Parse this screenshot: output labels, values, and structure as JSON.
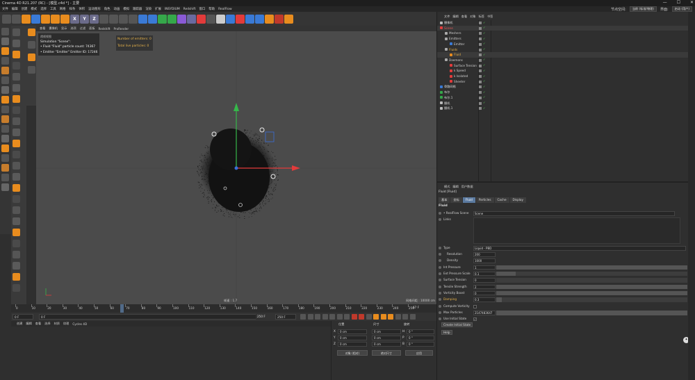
{
  "title": "Cinema 4D R21.207 (RC) - [模型.c4d *] - 主要",
  "menubar": [
    "文件",
    "编辑",
    "创建",
    "模式",
    "选择",
    "工具",
    "网格",
    "样条",
    "体积",
    "运动图形",
    "角色",
    "动画",
    "模拟",
    "跟踪器",
    "渲染",
    "扩展",
    "INSYDIUM",
    "Redshift",
    "窗口",
    "帮助",
    "RealFlow"
  ],
  "right_menubar": {
    "node_label": "节点空间:",
    "node_value": "当前 (标准/物理)",
    "layout_label": "界面:",
    "layout_value": "启动 (用户)"
  },
  "toolbar_icons": [
    "undo-icon",
    "redo-icon",
    "live-select-icon",
    "move-icon",
    "scale-icon",
    "rotate-icon",
    "recent-tool-icon",
    "x-axis-icon",
    "y-axis-icon",
    "z-axis-icon",
    "coordinate-system-icon",
    "render-view-icon",
    "render-picture-viewer-icon",
    "edit-render-settings-icon",
    "cube-icon",
    "spline-pen-icon",
    "subdivision-icon",
    "cloner-icon",
    "deformer-icon",
    "field-icon",
    "scene-icon",
    "camera-icon",
    "light-icon",
    "fluid-icon",
    "emitter-icon",
    "mesher-icon",
    "daemon-icon",
    "xp-icon",
    "redshift-icon",
    "octane-icon"
  ],
  "toolbar_axis_labels": {
    "x": "X",
    "y": "Y",
    "z": "Z"
  },
  "viewport_menu": [
    "查看",
    "摄像机",
    "显示",
    "选项",
    "过滤",
    "面板",
    "Redshift",
    "ProRender"
  ],
  "viewport_view_label": "透视视图",
  "simulation_info": {
    "title": "Simulation \"Scene\":",
    "fluid_line": "• Fluid \"Fluid\" particle count: 74367",
    "emitter_line": "• Emitter \"Emitter\" Emitter ID: 17246"
  },
  "emitter_stats": {
    "emitters": "Number of emitters: 0",
    "particles": "Total live particles: 0"
  },
  "viewport_footer": {
    "fps": "帧速 : 1.7",
    "grid": "网格间距 : 10000 cm"
  },
  "timeline_ticks": [
    "0",
    "10",
    "20",
    "30",
    "40",
    "50",
    "60",
    "70",
    "80",
    "90",
    "100",
    "110",
    "120",
    "130",
    "140",
    "150",
    "160",
    "170",
    "180",
    "190",
    "200",
    "210",
    "220",
    "230",
    "240",
    "250"
  ],
  "timeline_current": "67 F",
  "transport": {
    "start": "0 F",
    "current": "0 F",
    "end_min": "250 F",
    "end_max": "250 F"
  },
  "bottom_menu": [
    "创建",
    "编辑",
    "查看",
    "选择",
    "材质",
    "纹理",
    "Cycles 4D"
  ],
  "coord_panel": {
    "h_pos": "位置",
    "h_size": "尺寸",
    "h_rot": "旋转",
    "rows": [
      {
        "axis": "X",
        "pos": "0 cm",
        "size": "0 cm",
        "rot_axis": "H",
        "rot": "0 °"
      },
      {
        "axis": "Y",
        "pos": "0 cm",
        "size": "0 cm",
        "rot_axis": "P",
        "rot": "0 °"
      },
      {
        "axis": "Z",
        "pos": "0 cm",
        "size": "0 cm",
        "rot_axis": "B",
        "rot": "0 °"
      }
    ],
    "mode_select": "对象 (相对)",
    "size_select": "绝对尺寸",
    "apply": "应用"
  },
  "object_menu": [
    "文件",
    "编辑",
    "查看",
    "对象",
    "标签",
    "书签"
  ],
  "objects": [
    {
      "name": "摄像机",
      "indent": 0,
      "color": "#d8d8d8",
      "icon": "camera-icon"
    },
    {
      "name": "Scene",
      "indent": 0,
      "color": "#e65a5a",
      "icon": "scene-icon"
    },
    {
      "name": "Meshers",
      "indent": 1,
      "color": "#cfcfcf",
      "icon": "folder-icon"
    },
    {
      "name": "Emitters",
      "indent": 1,
      "color": "#cfcfcf",
      "icon": "folder-icon"
    },
    {
      "name": "Emitter",
      "indent": 2,
      "color": "#cfcfcf",
      "icon": "emitter-icon"
    },
    {
      "name": "Fluids",
      "indent": 1,
      "color": "#e7b34a",
      "icon": "folder-icon"
    },
    {
      "name": "Fluid",
      "indent": 2,
      "color": "#e7b34a",
      "icon": "fluid-icon"
    },
    {
      "name": "Daemons",
      "indent": 1,
      "color": "#cfcfcf",
      "icon": "folder-icon"
    },
    {
      "name": "Surface Tension",
      "indent": 2,
      "color": "#cfcfcf",
      "icon": "daemon-icon"
    },
    {
      "name": "k Speed",
      "indent": 2,
      "color": "#cfcfcf",
      "icon": "daemon-icon"
    },
    {
      "name": "k Isolated",
      "indent": 2,
      "color": "#cfcfcf",
      "icon": "daemon-icon"
    },
    {
      "name": "Sheeter",
      "indent": 2,
      "color": "#cfcfcf",
      "icon": "daemon-icon"
    },
    {
      "name": "骨骼网格",
      "indent": 0,
      "color": "#d8d8d8",
      "icon": "mesh-icon"
    },
    {
      "name": "布尔",
      "indent": 0,
      "color": "#d8d8d8",
      "icon": "boole-icon"
    },
    {
      "name": "布尔.1",
      "indent": 0,
      "color": "#d8d8d8",
      "icon": "boole-icon"
    },
    {
      "name": "摄机",
      "indent": 0,
      "color": "#d8d8d8",
      "icon": "camera-icon"
    },
    {
      "name": "摄机.1",
      "indent": 0,
      "color": "#d8d8d8",
      "icon": "camera-icon"
    }
  ],
  "attr_menu": [
    "模式",
    "编辑",
    "用户数据"
  ],
  "attr_title": "Fluid [Fluid]",
  "attr_tabs": [
    "基本",
    "坐标",
    "Fluid",
    "Particles",
    "Cache",
    "Display"
  ],
  "attr_active_tab": "Fluid",
  "fluid_header": "Fluid",
  "scene_label": "• RealFlow Scene",
  "scene_value": "Scene",
  "links_label": "Links",
  "type_label": "Type",
  "type_value": "Liquid - PBD",
  "params": [
    {
      "name": "Resolution",
      "value": "200",
      "slider": null
    },
    {
      "name": "Density",
      "value": "1000",
      "slider": null
    },
    {
      "name": "Int Pressure",
      "value": "1",
      "slider": 1.0
    },
    {
      "name": "Ext Pressure Scale",
      "value": "0.1",
      "slider": 0.1
    },
    {
      "name": "Surface Tension",
      "value": "0",
      "slider": 0.0
    },
    {
      "name": "Tensile Strength",
      "value": "2",
      "slider": 1.0
    },
    {
      "name": "Vorticity Boost",
      "value": "0",
      "slider": 1.0
    },
    {
      "name": "Damping",
      "value": "0.3",
      "slider": 0.03
    }
  ],
  "compute_vorticity": "Compute Vorticity",
  "max_particles_label": "Max Particles",
  "max_particles_value": "2147483647",
  "use_initial_state": "Use Initial State",
  "create_initial_state": "Create Initial State",
  "help": "Help",
  "colors": {
    "accent": "#5b7aa0",
    "axis_x": "#e23b3b",
    "axis_y": "#35b84a",
    "axis_z": "#3a6ed8",
    "fluid_particles": "#1a1a1a"
  }
}
